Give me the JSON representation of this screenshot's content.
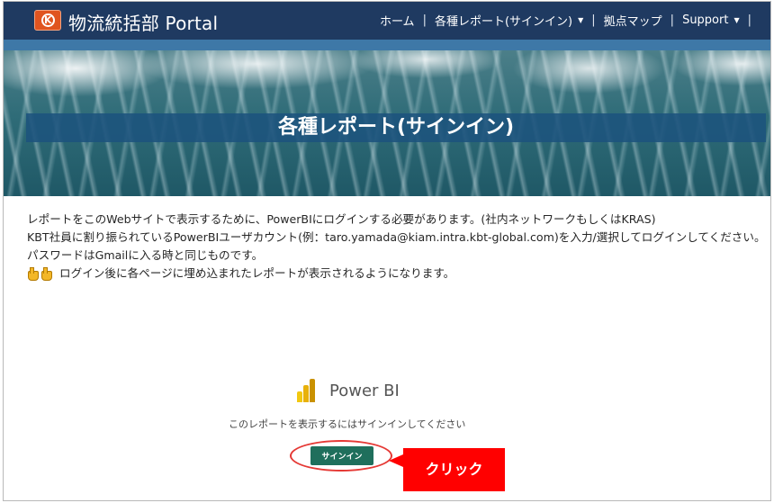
{
  "header": {
    "title": "物流統括部 Portal",
    "nav": [
      {
        "label": "ホーム"
      },
      {
        "label": "各種レポート(サインイン)",
        "dropdown": true
      },
      {
        "label": "拠点マップ"
      },
      {
        "label": "Support",
        "dropdown": true
      }
    ],
    "separator": "|"
  },
  "hero": {
    "title": "各種レポート(サインイン)"
  },
  "content": {
    "lines": [
      "レポートをこのWebサイトで表示するために、PowerBIにログインする必要があります。(社内ネットワークもしくはKRAS)",
      "KBT社員に割り振られているPowerBIユーザカウント(例：taro.yamada@kiam.intra.kbt-global.com)を入力/選択してログインしてください。",
      "パスワードはGmailに入る時と同じものです。",
      "ログイン後に各ページに埋め込まれたレポートが表示されるようになります。"
    ]
  },
  "powerbi": {
    "title": "Power BI",
    "message": "このレポートを表示するにはサインインしてください",
    "signin_label": "サインイン"
  },
  "annotation": {
    "label": "クリック",
    "color": "#ff0000"
  },
  "colors": {
    "header_bg": "#1f3a61",
    "accent": "#3e78a7",
    "signin_bg": "#1f6f5c"
  }
}
